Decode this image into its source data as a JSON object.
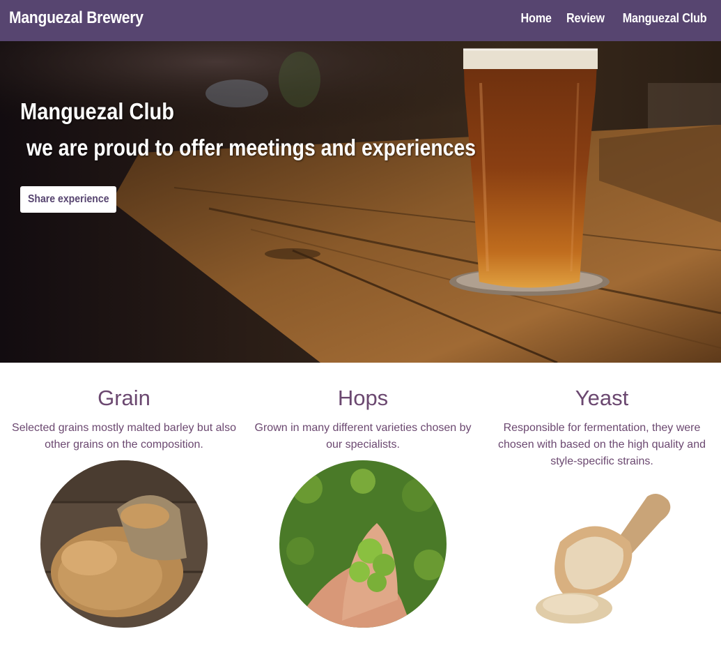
{
  "navbar": {
    "brand": "Manguezal Brewery",
    "links": [
      "Home",
      "Review",
      "Manguezal Club"
    ]
  },
  "hero": {
    "title": "Manguezal Club",
    "subtitle": "we are proud to offer meetings and experiences",
    "button_label": "Share experience",
    "image": "beer-pint-on-wooden-bar-image"
  },
  "features": [
    {
      "title": "Grain",
      "description": "Selected grains mostly malted barley but also other grains on the composition.",
      "image": "barley-grain-sack-image"
    },
    {
      "title": "Hops",
      "description": "Grown in many different varieties chosen by our specialists.",
      "image": "hands-holding-hops-image"
    },
    {
      "title": "Yeast",
      "description": "Responsible for fermentation, they were chosen with based on the high quality and style-specific strains.",
      "image": "yeast-wooden-scoop-image"
    }
  ],
  "colors": {
    "brand": "#574570",
    "accent_text": "#6b4870",
    "button_bg": "#ffffff"
  }
}
